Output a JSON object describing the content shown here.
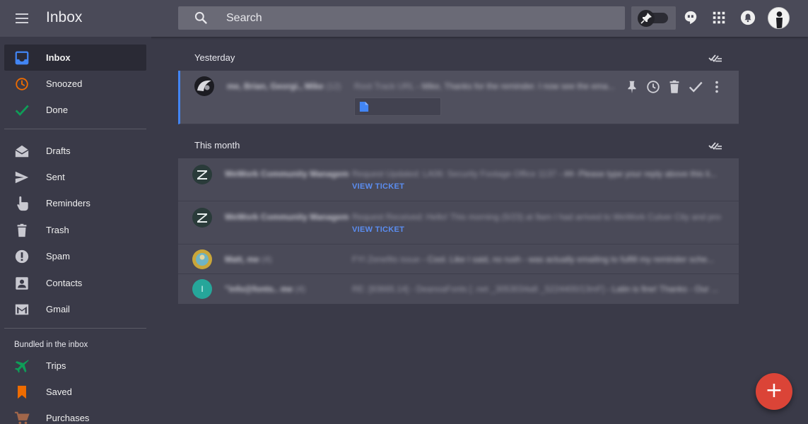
{
  "header": {
    "title": "Inbox",
    "search_placeholder": "Search"
  },
  "sidebar": {
    "items": [
      {
        "label": "Inbox",
        "icon": "inbox-icon",
        "color": "#4285f4",
        "active": true
      },
      {
        "label": "Snoozed",
        "icon": "clock-icon",
        "color": "#ef6c00"
      },
      {
        "label": "Done",
        "icon": "check-icon",
        "color": "#0f9d58"
      },
      {
        "label": "Drafts",
        "icon": "drafts-icon",
        "color": "#c8c8d0"
      },
      {
        "label": "Sent",
        "icon": "send-icon",
        "color": "#c8c8d0"
      },
      {
        "label": "Reminders",
        "icon": "reminder-hand-icon",
        "color": "#c8c8d0"
      },
      {
        "label": "Trash",
        "icon": "trash-icon",
        "color": "#c8c8d0"
      },
      {
        "label": "Spam",
        "icon": "spam-icon",
        "color": "#c8c8d0"
      },
      {
        "label": "Contacts",
        "icon": "contacts-icon",
        "color": "#c8c8d0"
      },
      {
        "label": "Gmail",
        "icon": "gmail-icon",
        "color": "#c8c8d0"
      }
    ],
    "bundled_label": "Bundled in the inbox",
    "bundles": [
      {
        "label": "Trips",
        "icon": "plane-icon",
        "color": "#0f9d58"
      },
      {
        "label": "Saved",
        "icon": "bookmark-icon",
        "color": "#ef6c00"
      },
      {
        "label": "Purchases",
        "icon": "cart-icon",
        "color": "#a1664a"
      }
    ]
  },
  "main": {
    "groups": [
      {
        "label": "Yesterday",
        "threads": [
          {
            "sender": "me, Brian, Georgi., Mike",
            "count": "(12)",
            "subject": "Root Track URL",
            "snippet": " - Mike, Thanks for the reminder. I now see the ema...",
            "has_attachment": true,
            "selected": true
          }
        ]
      },
      {
        "label": "This month",
        "threads": [
          {
            "sender": "WeWork Community Managem",
            "count": "",
            "subject": "Request Updated: LA06: Security Footage Office 1137",
            "snippet": " - ##- Please type your reply above this li...",
            "action_label": "VIEW TICKET"
          },
          {
            "sender": "WeWork Community Managem",
            "count": "",
            "subject": "Request Received: Hello! This morning (5/23) at 9am I had arrived to WeWork Culver City and proce...",
            "snippet": "",
            "action_label": "VIEW TICKET"
          },
          {
            "sender": "Matt, me",
            "count": "(4)",
            "subject": "FYI Zenefits issue",
            "snippet": " - Cool. Like I said, no rush - was actually emailing to fulfill my reminder sche..."
          },
          {
            "sender": "\"info@fonts.. me",
            "count": "(4)",
            "subject": "RE: [93665.14] - DeanoaFonts [ .net _3053034a8 _5224400/13mF]",
            "snippet": " - Latin is fine! Thanks - Our ..."
          }
        ]
      }
    ],
    "avatar_letter": "I"
  },
  "colors": {
    "accent": "#4285f4",
    "fab": "#db4437",
    "link": "#5b8df0"
  }
}
